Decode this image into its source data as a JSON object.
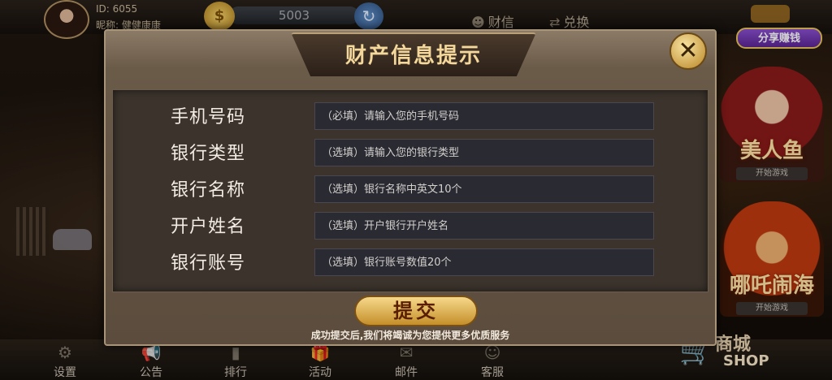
{
  "user": {
    "id_text": "ID: 6055",
    "nickname_text": "昵称: 健健康康"
  },
  "coins": {
    "value": "5003",
    "coin_glyph": "$",
    "refresh_glyph": "↻"
  },
  "top_links": [
    {
      "label": "财信",
      "icon": "user-icon",
      "glyph": "☻"
    },
    {
      "label": "兑换",
      "icon": "exchange-icon",
      "glyph": "⇄"
    }
  ],
  "share": {
    "label": "分享赚钱"
  },
  "games": [
    {
      "name": "美人鱼",
      "play": "开始游戏"
    },
    {
      "name": "哪吒闹海",
      "play": "开始游戏"
    }
  ],
  "dialog": {
    "title": "财产信息提示",
    "close_glyph": "✕",
    "fields": [
      {
        "label": "手机号码",
        "placeholder": "（必填）请输入您的手机号码"
      },
      {
        "label": "银行类型",
        "placeholder": "（选填）请输入您的银行类型"
      },
      {
        "label": "银行名称",
        "placeholder": "（选填）银行名称中英文10个"
      },
      {
        "label": "开户姓名",
        "placeholder": "（选填）开户银行开户姓名"
      },
      {
        "label": "银行账号",
        "placeholder": "（选填）银行账号数值20个"
      }
    ],
    "submit_label": "提交",
    "note": "成功提交后,我们将竭诚为您提供更多优质服务"
  },
  "bottom_nav": [
    {
      "label": "设置",
      "icon": "gear-icon",
      "glyph": "⚙"
    },
    {
      "label": "公告",
      "icon": "megaphone-icon",
      "glyph": "📢"
    },
    {
      "label": "排行",
      "icon": "ranking-icon",
      "glyph": "▮"
    },
    {
      "label": "活动",
      "icon": "gift-icon",
      "glyph": "🎁"
    },
    {
      "label": "邮件",
      "icon": "mail-icon",
      "glyph": "✉"
    },
    {
      "label": "客服",
      "icon": "support-icon",
      "glyph": "☺"
    }
  ],
  "shop": {
    "title": "商城",
    "subtitle": "SHOP",
    "icon": "cart-icon",
    "glyph": "🛒"
  }
}
